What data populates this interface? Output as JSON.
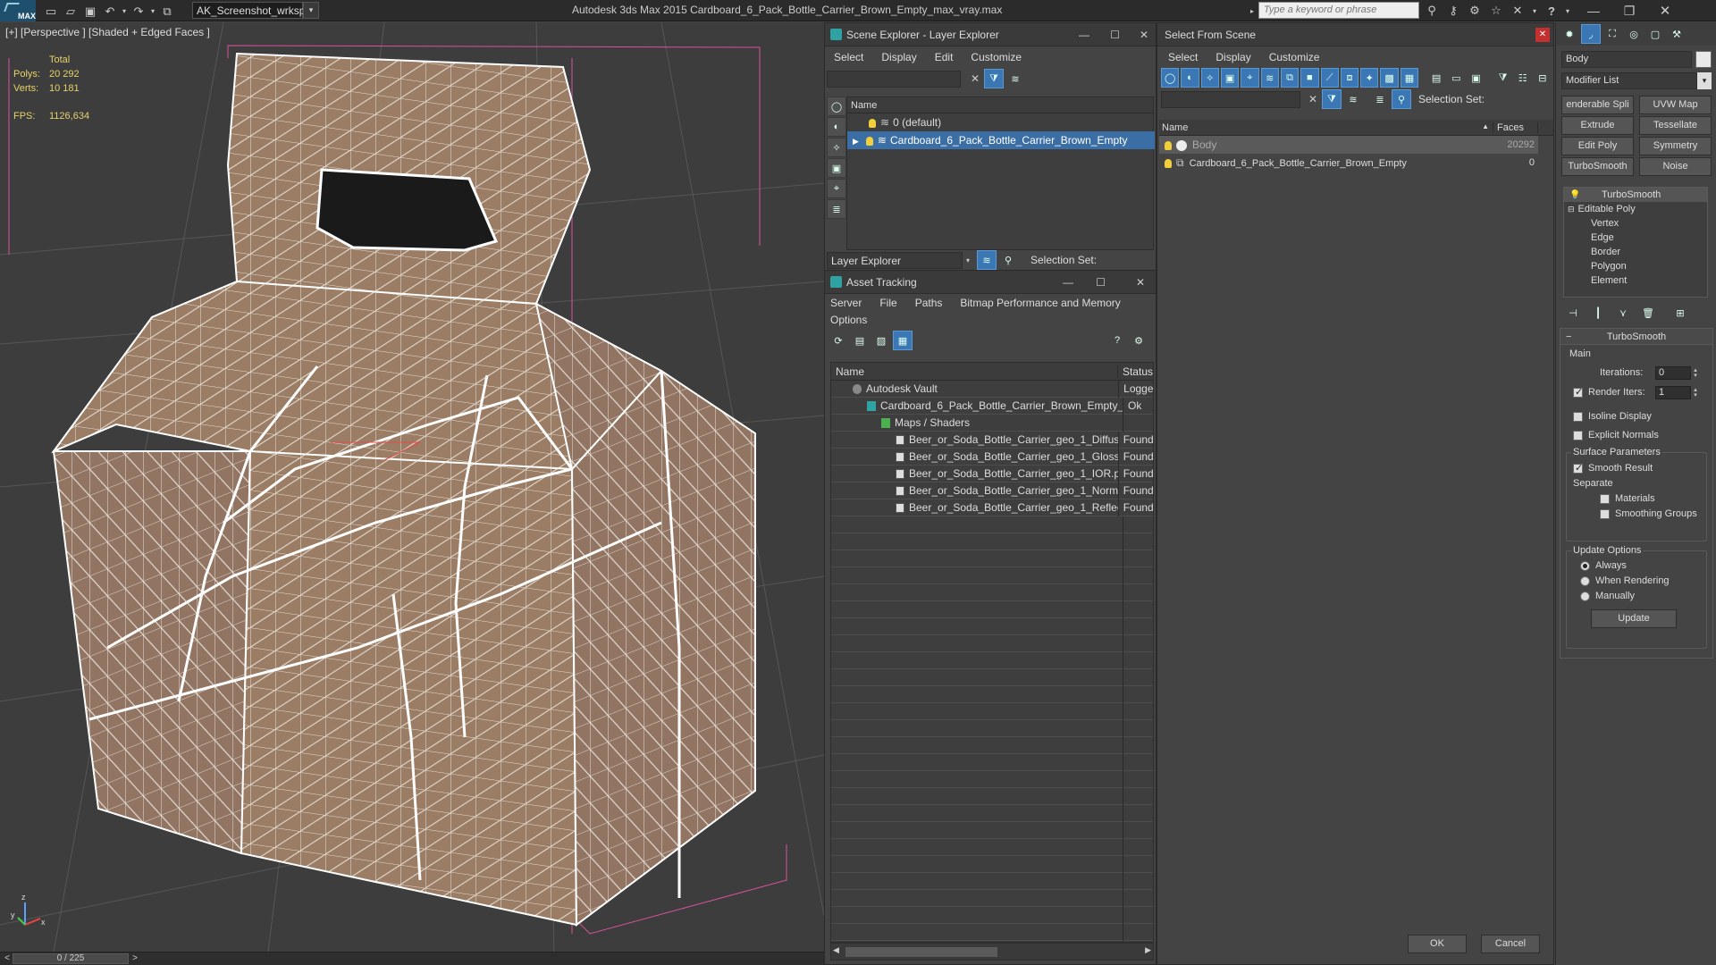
{
  "titlebar": {
    "logo": "MAX",
    "workspace": "AK_Screenshot_wrksp",
    "app_title": "Autodesk 3ds Max  2015    Cardboard_6_Pack_Bottle_Carrier_Brown_Empty_max_vray.max",
    "search_placeholder": "Type a keyword or phrase"
  },
  "viewport": {
    "label": "[+] [Perspective ] [Shaded + Edged Faces ]",
    "stats": {
      "total_label": "Total",
      "polys_label": "Polys:",
      "polys_value": "20 292",
      "verts_label": "Verts:",
      "verts_value": "10 181",
      "fps_label": "FPS:",
      "fps_value": "1126,634"
    },
    "axis": {
      "x": "x",
      "y": "y",
      "z": "z"
    }
  },
  "timebar": {
    "frame": "0 / 225",
    "prev": "<",
    "next": ">"
  },
  "scene_explorer": {
    "title": "Scene Explorer - Layer Explorer",
    "menu": [
      "Select",
      "Display",
      "Edit",
      "Customize"
    ],
    "column": "Name",
    "rows": [
      "0 (default)",
      "Cardboard_6_Pack_Bottle_Carrier_Brown_Empty"
    ],
    "footer_dropdown": "Layer Explorer",
    "selection_set": "Selection Set:"
  },
  "asset_tracking": {
    "title": "Asset Tracking",
    "menu": [
      "Server",
      "File",
      "Paths",
      "Bitmap Performance and Memory"
    ],
    "menu2": "Options",
    "col_name": "Name",
    "col_status": "Status",
    "rows": [
      {
        "name": "Autodesk Vault",
        "status": "Logge",
        "indent": 1
      },
      {
        "name": "Cardboard_6_Pack_Bottle_Carrier_Brown_Empty_...",
        "status": "Ok",
        "indent": 2
      },
      {
        "name": "Maps / Shaders",
        "status": "",
        "indent": 3
      },
      {
        "name": "Beer_or_Soda_Bottle_Carrier_geo_1_Diffuse...",
        "status": "Found",
        "indent": 4
      },
      {
        "name": "Beer_or_Soda_Bottle_Carrier_geo_1_Glossin...",
        "status": "Found",
        "indent": 4
      },
      {
        "name": "Beer_or_Soda_Bottle_Carrier_geo_1_IOR.png",
        "status": "Found",
        "indent": 4
      },
      {
        "name": "Beer_or_Soda_Bottle_Carrier_geo_1_Norma...",
        "status": "Found",
        "indent": 4
      },
      {
        "name": "Beer_or_Soda_Bottle_Carrier_geo_1_Reflecti...",
        "status": "Found",
        "indent": 4
      }
    ]
  },
  "select_from_scene": {
    "title": "Select From Scene",
    "menu": [
      "Select",
      "Display",
      "Customize"
    ],
    "selection_set": "Selection Set:",
    "col_name": "Name",
    "col_faces": "Faces",
    "rows": [
      {
        "name": "Body",
        "faces": "20292"
      },
      {
        "name": "Cardboard_6_Pack_Bottle_Carrier_Brown_Empty",
        "faces": "0"
      }
    ],
    "ok": "OK",
    "cancel": "Cancel"
  },
  "modify_panel": {
    "object_name": "Body",
    "modifier_list": "Modifier List",
    "buttons": [
      "enderable Spli",
      "UVW Map",
      "Extrude",
      "Tessellate",
      "Edit Poly",
      "Symmetry",
      "TurboSmooth",
      "Noise"
    ],
    "stack": {
      "top": "TurboSmooth",
      "base": "Editable Poly",
      "subs": [
        "Vertex",
        "Edge",
        "Border",
        "Polygon",
        "Element"
      ]
    },
    "rollout_title": "TurboSmooth",
    "main_label": "Main",
    "iterations_label": "Iterations:",
    "iterations_value": "0",
    "render_iters_label": "Render Iters:",
    "render_iters_value": "1",
    "isoline_label": "Isoline Display",
    "explicit_label": "Explicit Normals",
    "surface_label": "Surface Parameters",
    "smooth_result_label": "Smooth Result",
    "separate_label": "Separate",
    "materials_label": "Materials",
    "smoothing_groups_label": "Smoothing Groups",
    "update_options_label": "Update Options",
    "always_label": "Always",
    "when_rendering_label": "When Rendering",
    "manually_label": "Manually",
    "update_button": "Update"
  },
  "colors": {
    "accent": "#3b6ea5",
    "bulb": "#f2cf3a",
    "cardboard": "#9a7d64",
    "wire": "#f2f2f2"
  }
}
